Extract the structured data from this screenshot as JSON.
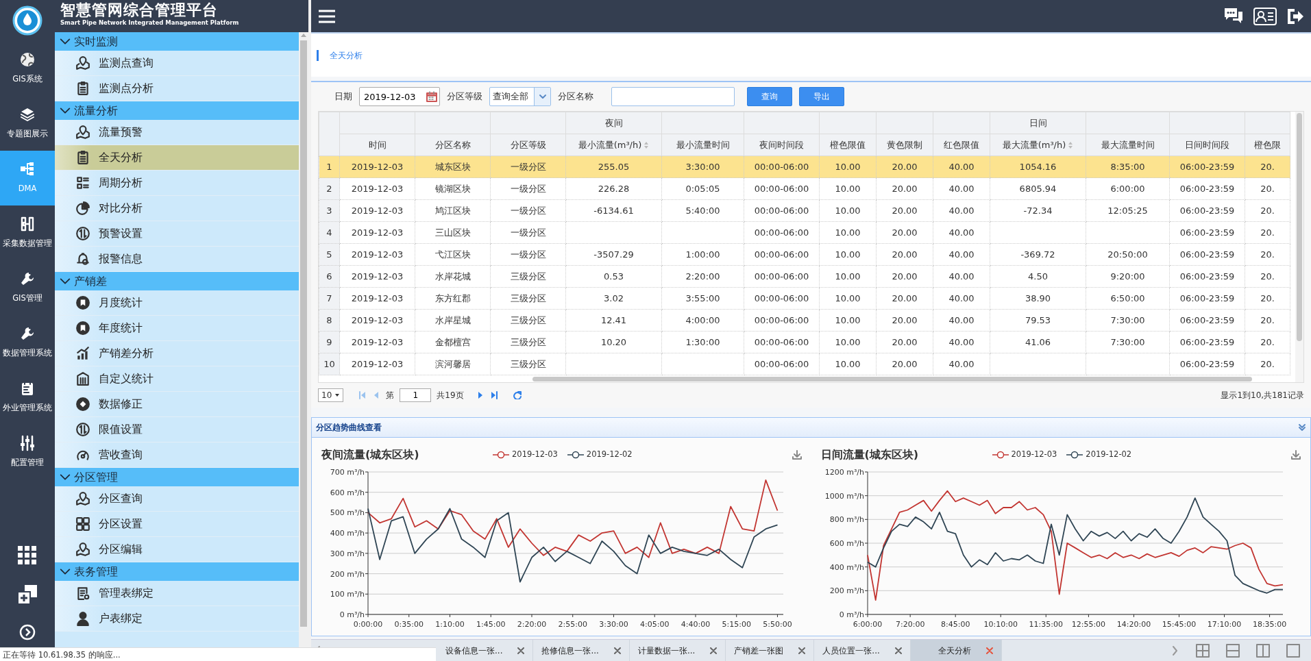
{
  "app": {
    "title": "智慧管网综合管理平台",
    "subtitle": "Smart Pipe Network Integrated Management Platform"
  },
  "rail": [
    {
      "label": "GIS系统",
      "selected": false
    },
    {
      "label": "专题图展示",
      "selected": false
    },
    {
      "label": "DMA",
      "selected": true
    },
    {
      "label": "采集数据管理",
      "selected": false
    },
    {
      "label": "GIS管理",
      "selected": false
    },
    {
      "label": "数据管理系统",
      "selected": false
    },
    {
      "label": "外业管理系统",
      "selected": false
    },
    {
      "label": "配置管理",
      "selected": false
    }
  ],
  "menu": [
    {
      "label": "实时监测",
      "expanded": true,
      "items": [
        {
          "label": "监测点查询",
          "selected": false
        },
        {
          "label": "监测点分析",
          "selected": false
        }
      ]
    },
    {
      "label": "流量分析",
      "expanded": true,
      "items": [
        {
          "label": "流量预警",
          "selected": false
        },
        {
          "label": "全天分析",
          "selected": true
        },
        {
          "label": "周期分析",
          "selected": false
        },
        {
          "label": "对比分析",
          "selected": false
        },
        {
          "label": "预警设置",
          "selected": false
        },
        {
          "label": "报警信息",
          "selected": false
        }
      ]
    },
    {
      "label": "产销差",
      "expanded": true,
      "items": [
        {
          "label": "月度统计",
          "selected": false
        },
        {
          "label": "年度统计",
          "selected": false
        },
        {
          "label": "产销差分析",
          "selected": false
        },
        {
          "label": "自定义统计",
          "selected": false
        },
        {
          "label": "数据修正",
          "selected": false
        },
        {
          "label": "限值设置",
          "selected": false
        },
        {
          "label": "营收查询",
          "selected": false
        }
      ]
    },
    {
      "label": "分区管理",
      "expanded": true,
      "items": [
        {
          "label": "分区查询",
          "selected": false
        },
        {
          "label": "分区设置",
          "selected": false
        },
        {
          "label": "分区编辑",
          "selected": false
        }
      ]
    },
    {
      "label": "表务管理",
      "expanded": true,
      "items": [
        {
          "label": "管理表绑定",
          "selected": false
        },
        {
          "label": "户表绑定",
          "selected": false
        }
      ]
    }
  ],
  "breadcrumb": "全天分析",
  "filters": {
    "date_label": "日期",
    "date_value": "2019-12-03",
    "level_label": "分区等级",
    "level_value": "查询全部",
    "name_label": "分区名称",
    "query_button": "查询",
    "export_button": "导出"
  },
  "table": {
    "columns": [
      {
        "label": "时间",
        "sortable": false
      },
      {
        "label": "分区名称",
        "sortable": false
      },
      {
        "label": "分区等级",
        "sortable": false
      },
      {
        "label": "最小流量(m³/h)",
        "group": "夜间",
        "sortable": true
      },
      {
        "label": "最小流量时间",
        "sortable": false
      },
      {
        "label": "夜间时间段",
        "sortable": false
      },
      {
        "label": "橙色限值",
        "sortable": false
      },
      {
        "label": "黄色限制",
        "sortable": false
      },
      {
        "label": "红色限值",
        "sortable": false
      },
      {
        "label": "最大流量(m³/h)",
        "group": "日间",
        "sortable": true
      },
      {
        "label": "最大流量时间",
        "sortable": false
      },
      {
        "label": "日间时间段",
        "sortable": false
      },
      {
        "label": "橙色限",
        "sortable": false
      }
    ],
    "rows": [
      {
        "num": "1",
        "selected": true,
        "cells": [
          "2019-12-03",
          "城东区块",
          "一级分区",
          "255.05",
          "3:30:00",
          "00:00-06:00",
          "10.00",
          "20.00",
          "40.00",
          "1054.16",
          "8:35:00",
          "06:00-23:59",
          "20."
        ]
      },
      {
        "num": "2",
        "selected": false,
        "cells": [
          "2019-12-03",
          "镜湖区块",
          "一级分区",
          "226.28",
          "0:05:05",
          "00:00-06:00",
          "10.00",
          "20.00",
          "40.00",
          "6805.94",
          "6:00:00",
          "06:00-23:59",
          "20."
        ]
      },
      {
        "num": "3",
        "selected": false,
        "cells": [
          "2019-12-03",
          "鸠江区块",
          "一级分区",
          "-6134.61",
          "5:40:00",
          "00:00-06:00",
          "10.00",
          "20.00",
          "40.00",
          "-72.34",
          "12:05:25",
          "06:00-23:59",
          "20."
        ]
      },
      {
        "num": "4",
        "selected": false,
        "cells": [
          "2019-12-03",
          "三山区块",
          "一级分区",
          null,
          null,
          "00:00-06:00",
          "10.00",
          "20.00",
          "40.00",
          null,
          null,
          "06:00-23:59",
          "20."
        ]
      },
      {
        "num": "5",
        "selected": false,
        "cells": [
          "2019-12-03",
          "弋江区块",
          "一级分区",
          "-3507.29",
          "1:00:00",
          "00:00-06:00",
          "10.00",
          "20.00",
          "40.00",
          "-369.72",
          "20:50:00",
          "06:00-23:59",
          "20."
        ]
      },
      {
        "num": "6",
        "selected": false,
        "cells": [
          "2019-12-03",
          "水岸花城",
          "三级分区",
          "0.53",
          "2:20:00",
          "00:00-06:00",
          "10.00",
          "20.00",
          "40.00",
          "4.50",
          "9:20:00",
          "06:00-23:59",
          "20."
        ]
      },
      {
        "num": "7",
        "selected": false,
        "cells": [
          "2019-12-03",
          "东方红郡",
          "三级分区",
          "3.02",
          "3:55:00",
          "00:00-06:00",
          "10.00",
          "20.00",
          "40.00",
          "38.90",
          "6:50:00",
          "06:00-23:59",
          "20."
        ]
      },
      {
        "num": "8",
        "selected": false,
        "cells": [
          "2019-12-03",
          "水岸星城",
          "三级分区",
          "12.41",
          "4:00:00",
          "00:00-06:00",
          "10.00",
          "20.00",
          "40.00",
          "79.53",
          "7:30:00",
          "06:00-23:59",
          "20."
        ]
      },
      {
        "num": "9",
        "selected": false,
        "cells": [
          "2019-12-03",
          "金都檀宫",
          "三级分区",
          "10.20",
          "1:30:00",
          "00:00-06:00",
          "10.00",
          "20.00",
          "40.00",
          "41.06",
          "7:30:00",
          "06:00-23:59",
          "20."
        ]
      },
      {
        "num": "10",
        "selected": false,
        "cells": [
          "2019-12-03",
          "滨河馨居",
          "三级分区",
          null,
          null,
          "00:00-06:00",
          "10.00",
          "20.00",
          "40.00",
          null,
          null,
          "06:00-23:59",
          "20."
        ]
      }
    ]
  },
  "pager": {
    "page_size": "10",
    "page_label": "第",
    "page": "1",
    "total_pages": "共19页",
    "summary": "显示1到10,共181记录"
  },
  "trend_panel": {
    "title": "分区趋势曲线查看"
  },
  "charts": [
    {
      "title": "夜间流量(城东区块)",
      "chart_data": {
        "type": "line",
        "grid": true,
        "xlim": [
          0,
          355
        ],
        "ylim": [
          0,
          700
        ],
        "x": [
          0,
          10,
          20,
          30,
          40,
          50,
          60,
          70,
          80,
          90,
          100,
          110,
          120,
          130,
          140,
          150,
          160,
          170,
          180,
          190,
          200,
          210,
          220,
          230,
          240,
          250,
          260,
          270,
          280,
          290,
          300,
          310,
          320,
          330,
          340,
          350
        ],
        "xticks": [
          {
            "value": 0,
            "label": "0:00:00"
          },
          {
            "value": 35,
            "label": "0:35:00"
          },
          {
            "value": 70,
            "label": "1:10:00"
          },
          {
            "value": 105,
            "label": "1:45:00"
          },
          {
            "value": 140,
            "label": "2:20:00"
          },
          {
            "value": 175,
            "label": "2:55:00"
          },
          {
            "value": 210,
            "label": "3:30:00"
          },
          {
            "value": 245,
            "label": "4:05:00"
          },
          {
            "value": 280,
            "label": "4:40:00"
          },
          {
            "value": 315,
            "label": "5:15:00"
          },
          {
            "value": 350,
            "label": "5:50:00"
          }
        ],
        "yticks": [
          {
            "value": 0,
            "label": "0 m³/h"
          },
          {
            "value": 100,
            "label": "100 m³/h"
          },
          {
            "value": 200,
            "label": "200 m³/h"
          },
          {
            "value": 300,
            "label": "300 m³/h"
          },
          {
            "value": 400,
            "label": "400 m³/h"
          },
          {
            "value": 500,
            "label": "500 m³/h"
          },
          {
            "value": 600,
            "label": "600 m³/h"
          },
          {
            "value": 700,
            "label": "700 m³/h"
          }
        ],
        "series": [
          {
            "name": "2019-12-03",
            "color": "#c23531",
            "values": [
              500,
              450,
              470,
              570,
              430,
              460,
              420,
              510,
              490,
              410,
              370,
              470,
              330,
              420,
              350,
              290,
              330,
              310,
              390,
              360,
              400,
              410,
              300,
              330,
              280,
              450,
              300,
              320,
              300,
              330,
              300,
              530,
              420,
              410,
              660,
              510
            ]
          },
          {
            "name": "2019-12-02",
            "color": "#2f4554",
            "values": [
              520,
              270,
              460,
              480,
              300,
              370,
              420,
              520,
              370,
              330,
              280,
              460,
              500,
              160,
              280,
              330,
              260,
              310,
              280,
              250,
              360,
              310,
              240,
              200,
              390,
              300,
              330,
              310,
              300,
              290,
              320,
              270,
              230,
              380,
              420,
              440
            ]
          }
        ]
      }
    },
    {
      "title": "日间流量(城东区块)",
      "chart_data": {
        "type": "line",
        "grid": true,
        "xlim": [
          360,
          1140
        ],
        "ylim": [
          0,
          1200
        ],
        "x": [
          360,
          375,
          390,
          405,
          420,
          435,
          450,
          465,
          480,
          495,
          510,
          525,
          540,
          555,
          570,
          585,
          600,
          615,
          630,
          645,
          660,
          675,
          690,
          705,
          720,
          735,
          750,
          765,
          780,
          795,
          810,
          825,
          840,
          855,
          870,
          885,
          900,
          915,
          930,
          945,
          960,
          975,
          990,
          1005,
          1020,
          1035,
          1050,
          1065,
          1080,
          1095,
          1110,
          1125,
          1140
        ],
        "xticks": [
          {
            "value": 360,
            "label": "6:00:00"
          },
          {
            "value": 440,
            "label": "7:20:00"
          },
          {
            "value": 525,
            "label": "8:45:00"
          },
          {
            "value": 610,
            "label": "10:10:00"
          },
          {
            "value": 695,
            "label": "11:35:00"
          },
          {
            "value": 775,
            "label": "12:55:00"
          },
          {
            "value": 860,
            "label": "14:20:00"
          },
          {
            "value": 945,
            "label": "15:45:00"
          },
          {
            "value": 1030,
            "label": "17:10:00"
          },
          {
            "value": 1115,
            "label": "18:35:00"
          }
        ],
        "yticks": [
          {
            "value": 0,
            "label": "0 m³/h"
          },
          {
            "value": 200,
            "label": "200 m³/h"
          },
          {
            "value": 400,
            "label": "400 m³/h"
          },
          {
            "value": 600,
            "label": "600 m³/h"
          },
          {
            "value": 800,
            "label": "800 m³/h"
          },
          {
            "value": 1000,
            "label": "1000 m³/h"
          },
          {
            "value": 1200,
            "label": "1200 m³/h"
          }
        ],
        "series": [
          {
            "name": "2019-12-03",
            "color": "#c23531",
            "values": [
              500,
              120,
              580,
              720,
              860,
              880,
              920,
              960,
              870,
              960,
              1040,
              950,
              980,
              950,
              920,
              960,
              850,
              900,
              900,
              950,
              880,
              900,
              840,
              700,
              170,
              600,
              560,
              520,
              480,
              500,
              470,
              520,
              480,
              500,
              470,
              510,
              480,
              500,
              520,
              490,
              540,
              560,
              520,
              570,
              560,
              550,
              580,
              600,
              560,
              380,
              260,
              240,
              250
            ]
          },
          {
            "name": "2019-12-02",
            "color": "#2f4554",
            "values": [
              440,
              400,
              560,
              700,
              760,
              740,
              820,
              780,
              720,
              860,
              700,
              680,
              500,
              400,
              460,
              420,
              520,
              450,
              470,
              460,
              500,
              450,
              430,
              760,
              500,
              840,
              720,
              620,
              700,
              660,
              690,
              640,
              700,
              620,
              680,
              650,
              720,
              640,
              600,
              700,
              820,
              980,
              820,
              760,
              700,
              620,
              330,
              260,
              230,
              200,
              180,
              210,
              210
            ]
          }
        ]
      }
    }
  ],
  "tabs": [
    {
      "label": "设备信息一张...",
      "selected": false
    },
    {
      "label": "抢修信息一张...",
      "selected": false
    },
    {
      "label": "计量数据一张...",
      "selected": false
    },
    {
      "label": "产销差一张图",
      "selected": false
    },
    {
      "label": "人员位置一张...",
      "selected": false
    },
    {
      "label": "全天分析",
      "selected": true
    }
  ],
  "status_text": "正在等待 10.61.98.35 的响应..."
}
